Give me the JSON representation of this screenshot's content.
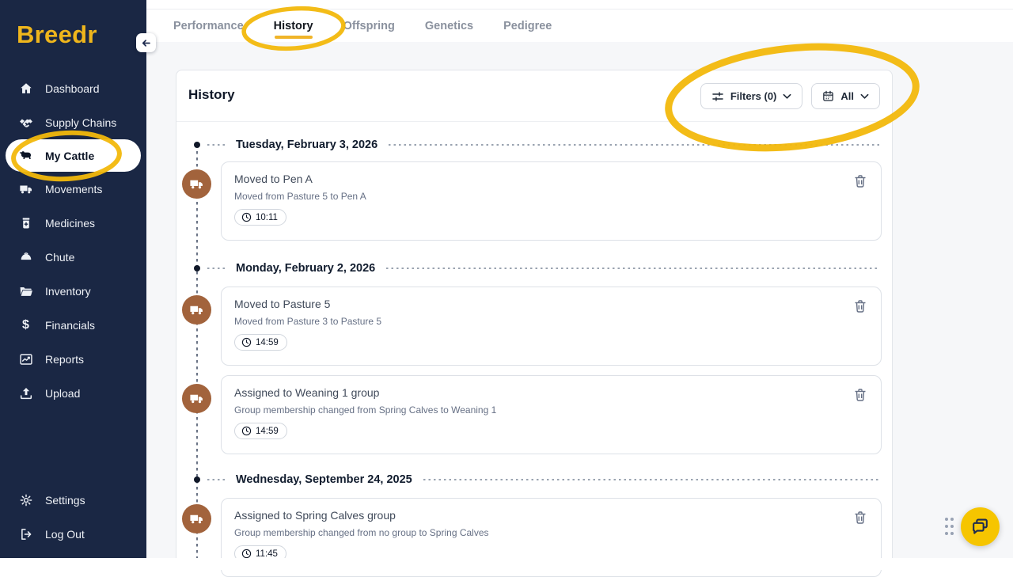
{
  "app": {
    "name": "Breedr"
  },
  "sidebar": {
    "items": [
      {
        "label": "Dashboard",
        "icon": "home-icon",
        "active": false
      },
      {
        "label": "Supply Chains",
        "icon": "handshake-icon",
        "active": false
      },
      {
        "label": "My Cattle",
        "icon": "cow-icon",
        "active": true
      },
      {
        "label": "Movements",
        "icon": "truck-icon",
        "active": false
      },
      {
        "label": "Medicines",
        "icon": "medicine-bottle-icon",
        "active": false
      },
      {
        "label": "Chute",
        "icon": "weight-icon",
        "active": false
      },
      {
        "label": "Inventory",
        "icon": "folder-icon",
        "active": false
      },
      {
        "label": "Financials",
        "icon": "dollar-icon",
        "active": false
      },
      {
        "label": "Reports",
        "icon": "line-chart-icon",
        "active": false
      },
      {
        "label": "Upload",
        "icon": "upload-icon",
        "active": false
      }
    ],
    "footer_items": [
      {
        "label": "Settings",
        "icon": "gear-icon"
      },
      {
        "label": "Log Out",
        "icon": "logout-icon"
      }
    ]
  },
  "tabs": [
    {
      "label": "Performance",
      "active": false
    },
    {
      "label": "History",
      "active": true
    },
    {
      "label": "Offspring",
      "active": false
    },
    {
      "label": "Genetics",
      "active": false
    },
    {
      "label": "Pedigree",
      "active": false
    }
  ],
  "panel": {
    "title": "History",
    "filters_button_label": "Filters (0)",
    "date_range_button_label": "All"
  },
  "timeline": {
    "groups": [
      {
        "date": "Tuesday, February 3, 2026",
        "events": [
          {
            "icon": "truck-icon",
            "title": "Moved to Pen A",
            "description": "Moved from Pasture 5 to Pen A",
            "time": "10:11"
          }
        ]
      },
      {
        "date": "Monday, February 2, 2026",
        "events": [
          {
            "icon": "truck-icon",
            "title": "Moved to Pasture 5",
            "description": "Moved from Pasture 3 to Pasture 5",
            "time": "14:59"
          },
          {
            "icon": "truck-icon",
            "title": "Assigned to Weaning 1 group",
            "description": "Group membership changed from Spring Calves to Weaning 1",
            "time": "14:59"
          }
        ]
      },
      {
        "date": "Wednesday, September 24, 2025",
        "events": [
          {
            "icon": "truck-icon",
            "title": "Assigned to Spring Calves group",
            "description": "Group membership changed from no group to Spring Calves",
            "time": "11:45"
          }
        ]
      }
    ]
  },
  "annotations": {
    "color": "#f2b80c",
    "circled_targets": [
      "tab-history",
      "sidebar-item-my-cattle",
      "panel-header-buttons"
    ]
  },
  "colors": {
    "sidebar_bg": "#1a2744",
    "brand_gold": "#efb61c",
    "active_tab_underline": "#f0b429",
    "event_icon_bg": "#a2633c",
    "chat_button_bg": "#f6c500",
    "content_bg": "#f6f7f9"
  }
}
